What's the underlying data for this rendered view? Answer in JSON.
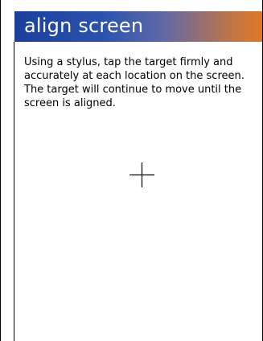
{
  "title": "align screen",
  "instructions": "Using a stylus, tap the target firmly and accurately at each location on the screen. The target will continue to move until the screen is aligned.",
  "target_icon": "crosshair-icon",
  "colors": {
    "title_gradient_start": "#1b3f9c",
    "title_gradient_end": "#e07a22",
    "title_text": "#ffffff",
    "body_text": "#000000",
    "background": "#ffffff"
  }
}
